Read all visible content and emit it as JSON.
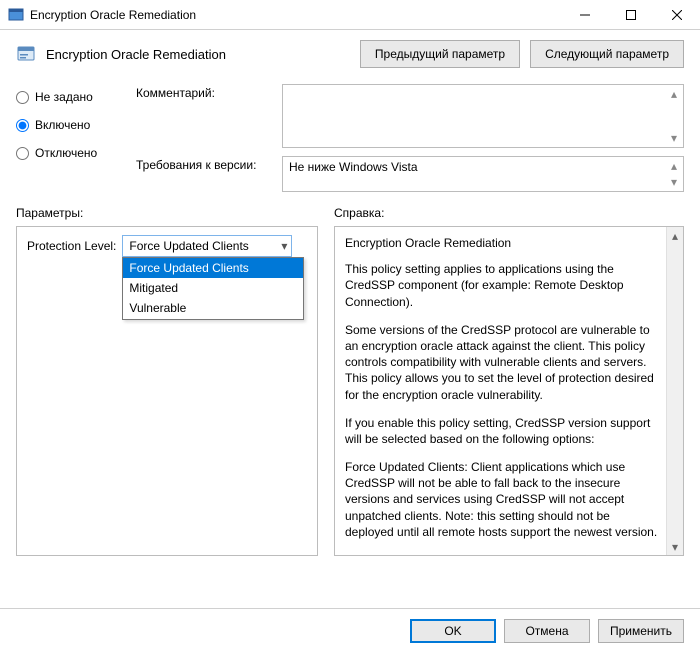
{
  "window": {
    "title": "Encryption Oracle Remediation"
  },
  "header": {
    "title": "Encryption Oracle Remediation",
    "prev_button": "Предыдущий параметр",
    "next_button": "Следующий параметр"
  },
  "state": {
    "not_configured": "Не задано",
    "enabled": "Включено",
    "disabled": "Отключено",
    "selected": "enabled"
  },
  "fields": {
    "comment_label": "Комментарий:",
    "comment_value": "",
    "version_label": "Требования к версии:",
    "version_value": "Не ниже Windows Vista"
  },
  "columns": {
    "params_label": "Параметры:",
    "help_label": "Справка:"
  },
  "params": {
    "protection_label": "Protection Level:",
    "protection_value": "Force Updated Clients",
    "options": [
      "Force Updated Clients",
      "Mitigated",
      "Vulnerable"
    ]
  },
  "help": {
    "title": "Encryption Oracle Remediation",
    "p1": "This policy setting applies to applications using the CredSSP component (for example: Remote Desktop Connection).",
    "p2": "Some versions of the CredSSP protocol are vulnerable to an encryption oracle attack against the client.  This policy controls compatibility with vulnerable clients and servers.  This policy allows you to set the level of protection desired for the encryption oracle vulnerability.",
    "p3": "If you enable this policy setting, CredSSP version support will be selected based on the following options:",
    "p4": "Force Updated Clients: Client applications which use CredSSP will not be able to fall back to the insecure versions and services using CredSSP will not accept unpatched clients. Note: this setting should not be deployed until all remote hosts support the newest version."
  },
  "buttons": {
    "ok": "OK",
    "cancel": "Отмена",
    "apply": "Применить"
  }
}
